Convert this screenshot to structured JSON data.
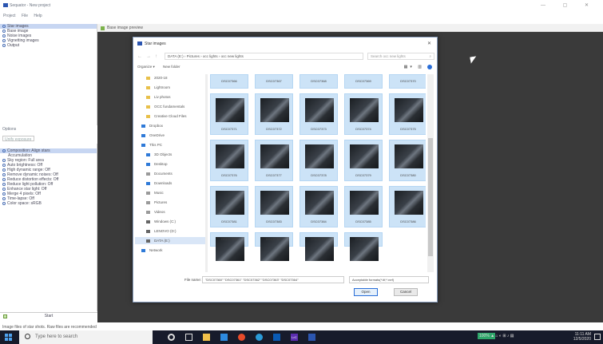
{
  "window": {
    "title": "Sequator - New project",
    "controls": "—  ▢  ✕"
  },
  "menu": [
    "Project",
    "File",
    "Help"
  ],
  "left_list": [
    {
      "label": "Star images",
      "selected": true
    },
    {
      "label": "Base image",
      "selected": false
    },
    {
      "label": "Noise images",
      "selected": false
    },
    {
      "label": "Vignetting images",
      "selected": false
    },
    {
      "label": "Output",
      "selected": false
    }
  ],
  "options": {
    "header": "Options",
    "disable_label": "Unify exposure"
  },
  "settings": [
    "Composition: Align stars",
    "Accumulation",
    "Sky region: Full area",
    "Auto brightness: Off",
    "High dynamic range: Off",
    "Remove dynamic noises: Off",
    "Reduce distortion effects: Off",
    "Reduce light pollution: Off",
    "Enhance star light: Off",
    "Merge 4 pixels: Off",
    "Time-lapse: Off",
    "Color space: sRGB"
  ],
  "start_label": "Start",
  "status_text": "Image files of star shots. Raw files are recommended",
  "preview_title": "Base image preview",
  "dialog": {
    "title": "Star images",
    "close": "✕",
    "path": "DATA (E:)  ›  Pictures  ›  occ lights  ›  occ new lights",
    "search_placeholder": "Search occ new lights",
    "toolbar": [
      "Organize ▾",
      "New folder"
    ],
    "nav": [
      {
        "label": "2020-18",
        "kind": "folder"
      },
      {
        "label": "Lightroom",
        "kind": "folder"
      },
      {
        "label": "Liv photos",
        "kind": "folder"
      },
      {
        "label": "OCC fundamentals",
        "kind": "folder"
      },
      {
        "label": "Creative Cloud Files",
        "kind": "folder"
      },
      {
        "label": "Dropbox",
        "kind": "blue"
      },
      {
        "label": "OneDrive",
        "kind": "blue"
      },
      {
        "label": "This PC",
        "kind": "blue"
      },
      {
        "label": "3D Objects",
        "kind": "blue"
      },
      {
        "label": "Desktop",
        "kind": "blue"
      },
      {
        "label": "Documents",
        "kind": "gray"
      },
      {
        "label": "Downloads",
        "kind": "blue"
      },
      {
        "label": "Music",
        "kind": "gray"
      },
      {
        "label": "Pictures",
        "kind": "gray"
      },
      {
        "label": "Videos",
        "kind": "gray"
      },
      {
        "label": "Windows (C:)",
        "kind": "drive"
      },
      {
        "label": "LENOVO (D:)",
        "kind": "drive"
      },
      {
        "label": "DATA (E:)",
        "kind": "drive",
        "selected": true
      },
      {
        "label": "Network",
        "kind": "blue"
      }
    ],
    "files_top": [
      "DSC07366",
      "DSC07367",
      "DSC07368",
      "DSC07369",
      "DSC07370"
    ],
    "files": [
      "DSC07371",
      "DSC07372",
      "DSC07373",
      "DSC07374",
      "DSC07375",
      "DSC07376",
      "DSC07377",
      "DSC07378",
      "DSC07379",
      "DSC07380",
      "DSC07381",
      "DSC07383",
      "DSC07384",
      "DSC07385",
      "DSC07386"
    ],
    "files_bottom": [
      "DSC07388",
      "DSC07389",
      "DSC07390",
      "DSC07392"
    ],
    "filename_label": "File name:",
    "filename_value": "\"DSC07360\" \"DSC07361\" \"DSC07362\" \"DSC07363\" \"DSC07364\"",
    "filter_value": "Acceptable formats(*.tif;*.nef)",
    "open_label": "Open",
    "cancel_label": "Cancel"
  },
  "taskbar": {
    "search_placeholder": "Type here to search",
    "time": "11:11 AM",
    "date": "12/5/2020",
    "badge": "100%"
  }
}
